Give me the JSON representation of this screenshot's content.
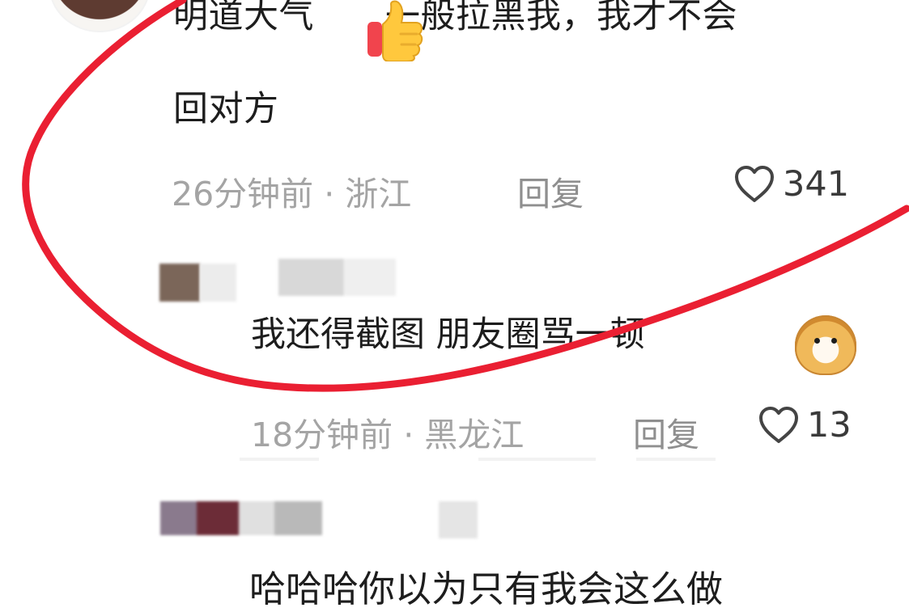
{
  "main_comment": {
    "line1": "明道大气",
    "line1_after_emoji": "一般拉黑我，我才不会",
    "line2": "回对方",
    "time_location": "26分钟前 · 浙江",
    "reply_label": "回复",
    "likes": "341"
  },
  "reply_comment": {
    "text": "我还得截图 朋友圈骂一顿",
    "time_location": "18分钟前 · 黑龙江",
    "reply_label": "回复",
    "likes": "13"
  },
  "next_comment": {
    "text": "哈哈哈你以为只有我会这么做"
  },
  "colors": {
    "red_annotation": "#ea1f32",
    "meta_text": "#a4a4a4"
  },
  "icons": {
    "like": "heart-icon",
    "thumb": "thumbs-up-emoji-icon",
    "dog": "shiba-emoji-icon"
  }
}
